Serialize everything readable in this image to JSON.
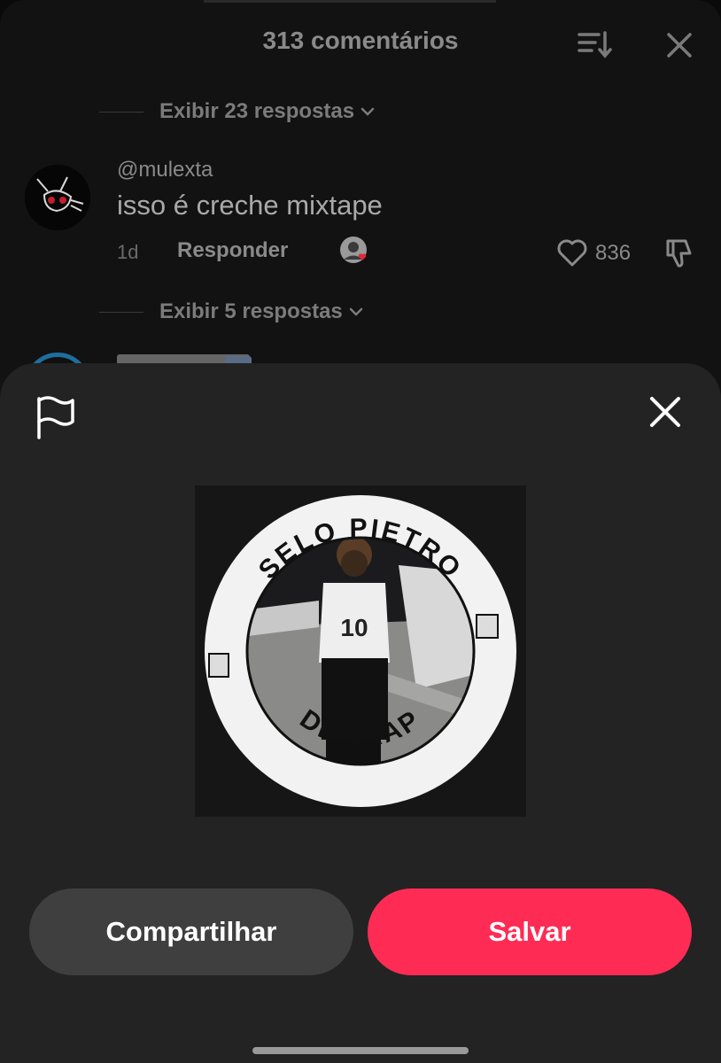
{
  "comments": {
    "title": "313 comentários",
    "replies_1": "Exibir 23 respostas",
    "comment": {
      "username": "@mulexta",
      "text": "isso é creche mixtape",
      "time": "1d",
      "reply_label": "Responder",
      "likes": "836"
    },
    "replies_2": "Exibir 5 respostas"
  },
  "sheet": {
    "image": {
      "top_text": "SELO PIETRO",
      "bottom_text": "DE TRAP",
      "jersey_number": "10"
    },
    "share_label": "Compartilhar",
    "save_label": "Salvar"
  },
  "colors": {
    "accent": "#fe2c55",
    "sheet_bg": "#232323",
    "secondary_button": "#3f3f3f"
  },
  "icons": [
    "sort-icon",
    "close-icon",
    "chevron-down-icon",
    "heart-icon",
    "dislike-icon",
    "flag-icon"
  ]
}
